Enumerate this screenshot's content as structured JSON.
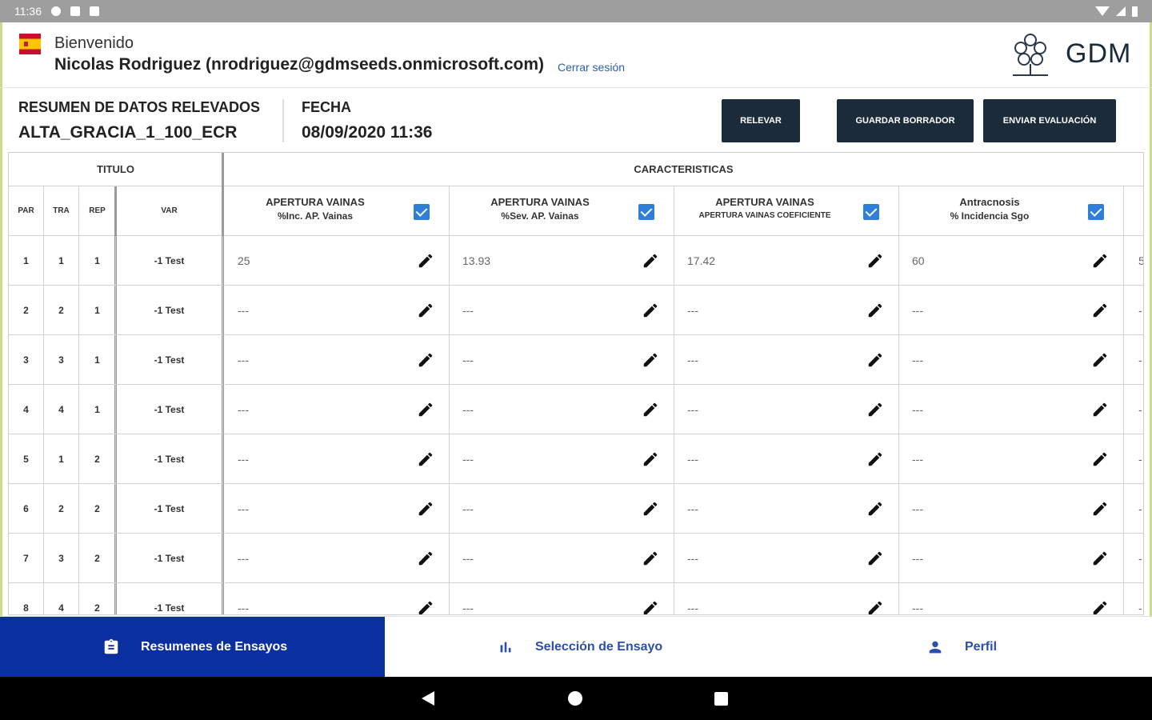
{
  "status_bar": {
    "time": "11:36"
  },
  "header": {
    "welcome": "Bienvenido",
    "user": "Nicolas Rodriguez (nrodriguez@gdmseeds.onmicrosoft.com)",
    "logout_label": "Cerrar sesión",
    "logo_text": "GDM"
  },
  "summary": {
    "label": "RESUMEN DE DATOS RELEVADOS",
    "value": "ALTA_GRACIA_1_100_ECR",
    "date_label": "FECHA",
    "date_value": "08/09/2020 11:36"
  },
  "actions": {
    "relevar": "RELEVAR",
    "guardar": "GUARDAR BORRADOR",
    "enviar": "ENVIAR EVALUACIÓN"
  },
  "table": {
    "group_titulo": "TITULO",
    "group_caracteristicas": "CARACTERISTICAS",
    "cols": {
      "par": "PAR",
      "tra": "TRA",
      "rep": "REP",
      "var": "VAR"
    },
    "characteristics": [
      {
        "title": "APERTURA VAINAS",
        "sub": "%Inc. AP. Vainas",
        "checked": true
      },
      {
        "title": "APERTURA VAINAS",
        "sub": "%Sev. AP. Vainas",
        "checked": true
      },
      {
        "title": "APERTURA VAINAS",
        "sub": "APERTURA VAINAS COEFICIENTE",
        "checked": true
      },
      {
        "title": "Antracnosis",
        "sub": "% Incidencia Sgo",
        "checked": true
      }
    ],
    "rows": [
      {
        "par": "1",
        "tra": "1",
        "rep": "1",
        "var": "-1 Test",
        "values": [
          "25",
          "13.93",
          "17.42",
          "60"
        ],
        "next": "5"
      },
      {
        "par": "2",
        "tra": "2",
        "rep": "1",
        "var": "-1 Test",
        "values": [
          "---",
          "---",
          "---",
          "---"
        ],
        "next": "-"
      },
      {
        "par": "3",
        "tra": "3",
        "rep": "1",
        "var": "-1 Test",
        "values": [
          "---",
          "---",
          "---",
          "---"
        ],
        "next": "-"
      },
      {
        "par": "4",
        "tra": "4",
        "rep": "1",
        "var": "-1 Test",
        "values": [
          "---",
          "---",
          "---",
          "---"
        ],
        "next": "-"
      },
      {
        "par": "5",
        "tra": "1",
        "rep": "2",
        "var": "-1 Test",
        "values": [
          "---",
          "---",
          "---",
          "---"
        ],
        "next": "-"
      },
      {
        "par": "6",
        "tra": "2",
        "rep": "2",
        "var": "-1 Test",
        "values": [
          "---",
          "---",
          "---",
          "---"
        ],
        "next": "-"
      },
      {
        "par": "7",
        "tra": "3",
        "rep": "2",
        "var": "-1 Test",
        "values": [
          "---",
          "---",
          "---",
          "---"
        ],
        "next": "-"
      },
      {
        "par": "8",
        "tra": "4",
        "rep": "2",
        "var": "-1 Test",
        "values": [
          "---",
          "---",
          "---",
          "---"
        ],
        "next": "-"
      }
    ]
  },
  "bottom_nav": [
    {
      "label": "Resumenes de Ensayos",
      "icon": "clipboard-icon",
      "active": true
    },
    {
      "label": "Selección de Ensayo",
      "icon": "bar-chart-icon",
      "active": false
    },
    {
      "label": "Perfil",
      "icon": "person-icon",
      "active": false
    }
  ],
  "colors": {
    "primary": "#0a2fa0",
    "button_dark": "#1c2b3a",
    "checkbox": "#2f7fd9",
    "link": "#2a5db0"
  }
}
